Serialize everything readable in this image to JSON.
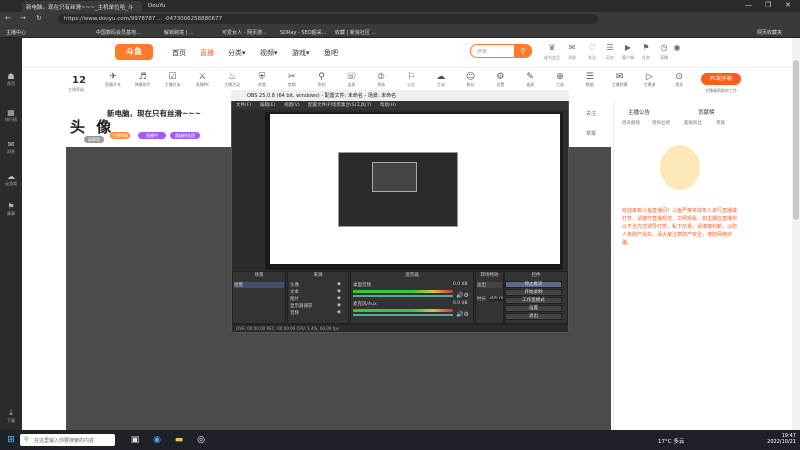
{
  "browser": {
    "tabs": [
      "新电脑，现在只有丝滑~~~_主机单位哈_斗",
      "DouYu"
    ],
    "url": "https://www.douyu.com/9978787 ... -0473006258880677",
    "bookmarks": [
      "主播中心",
      "中国数码会员基地...",
      "解锁跨境 | ...",
      "可爱女人 - 网页游...",
      "SDRay - SEO超采...",
      "收藏 | 新浪社区 ...",
      "网页收藏夹"
    ],
    "window_controls": [
      "—",
      "❐",
      "✕"
    ]
  },
  "sidebar": [
    {
      "label": "首页",
      "icon": "☗"
    },
    {
      "label": "排行榜",
      "icon": "▦"
    },
    {
      "label": "消息",
      "icon": "✉"
    },
    {
      "label": "云游戏",
      "icon": "☁"
    },
    {
      "label": "赛事",
      "icon": "⚑"
    },
    {
      "label": "下载",
      "icon": "⤓"
    }
  ],
  "nav": {
    "logo": "斗鱼",
    "items": [
      "首页",
      "直播",
      "分类▾",
      "视频▾",
      "游戏▾",
      "鱼吧"
    ],
    "active_index": 1,
    "search_placeholder": "搜索",
    "top_icons": [
      {
        "icon": "♛",
        "label": "成为会员"
      },
      {
        "icon": "✉",
        "label": "消息"
      },
      {
        "icon": "♡",
        "label": "关注"
      },
      {
        "icon": "☰",
        "label": "历史"
      },
      {
        "icon": "▶",
        "label": "客户端"
      },
      {
        "icon": "⚑",
        "label": "任务"
      },
      {
        "icon": "◷",
        "label": "直播"
      },
      {
        "icon": "◉",
        "label": ""
      }
    ]
  },
  "toolbar": {
    "count": "12",
    "count_label": "主播等级",
    "tools": [
      {
        "icon": "✈",
        "label": "直播开关"
      },
      {
        "icon": "♬",
        "label": "弹幕助手"
      },
      {
        "icon": "☑",
        "label": "主播任务"
      },
      {
        "icon": "⚔",
        "label": "直播PK"
      },
      {
        "icon": "♨",
        "label": "主播活动"
      },
      {
        "icon": "⛨",
        "label": "房管"
      },
      {
        "icon": "✂",
        "label": "剪辑"
      },
      {
        "icon": "⚲",
        "label": "鱼吧"
      },
      {
        "icon": "☏",
        "label": "连麦"
      },
      {
        "icon": "♔",
        "label": "贵族"
      },
      {
        "icon": "⚐",
        "label": "公告"
      },
      {
        "icon": "☁",
        "label": "互动"
      },
      {
        "icon": "☺",
        "label": "粉丝"
      },
      {
        "icon": "⚙",
        "label": "设置"
      },
      {
        "icon": "✎",
        "label": "道具"
      },
      {
        "icon": "⊕",
        "label": "工具"
      },
      {
        "icon": "☰",
        "label": "数据"
      },
      {
        "icon": "✉",
        "label": "主播招募"
      },
      {
        "icon": "▷",
        "label": "主播课"
      },
      {
        "icon": "⊙",
        "label": "更多"
      }
    ],
    "pc_button": "PC助手端",
    "pc_label": "主播端帮助你工作"
  },
  "room": {
    "title": "新电脑，现在只有丝滑~~~",
    "headline": "头 像",
    "tags": [
      "主播等级",
      "直播中",
      "超级粉丝团",
      "勋章墙"
    ],
    "follow_btn": "关注",
    "report_btn": "举报"
  },
  "chat": {
    "tabs": [
      "主播公告",
      "贡献榜"
    ],
    "subtabs": [
      "周贡献榜",
      "周粉丝榜",
      "超级粉丝",
      "贵族"
    ],
    "message": "欢迎来到斗鱼直播间！斗鱼严禁未成年人进行直播或打赏，请遵守直播规范，文明观看。如主播在直播中以不当方式诱导打赏、私下交易，请谨慎判断，以防人身财产损失。请大家注意财产安全，谨防网络诈骗。"
  },
  "obs": {
    "title": "OBS 25.0.8 (64 bit, windows) - 配置文件: 未命名 - 场景: 未命名",
    "menu": [
      "文件(F)",
      "编辑(E)",
      "视图(V)",
      "配置文件(P)",
      "场景集合(S)",
      "工具(T)",
      "帮助(H)"
    ],
    "docks": [
      "场景",
      "来源",
      "混音器",
      "转场特效",
      "控件"
    ],
    "scene": "场景",
    "sources": [
      "头像",
      "文本",
      "图片",
      "显示器捕获",
      "音频"
    ],
    "mixer": [
      "桌面音频",
      "麦克风/Aux"
    ],
    "mixer_db": [
      "0.0 dB",
      "0.0 dB"
    ],
    "transition": "淡出",
    "duration_label": "时长",
    "duration": "300 ms",
    "controls": [
      "停止推流",
      "开始录制",
      "工作室模式",
      "设置",
      "退出"
    ],
    "status": "LIVE: 00:00:00   REC: 00:00:00   CPU: 1.4%, 60.00 fps"
  },
  "taskbar": {
    "search": "在这里输入你要搜索的内容",
    "weather": "17°C 多云",
    "time": "19:47",
    "date": "2022/10/21"
  },
  "colors": {
    "accent": "#ff5d23",
    "dark": "#202020"
  }
}
